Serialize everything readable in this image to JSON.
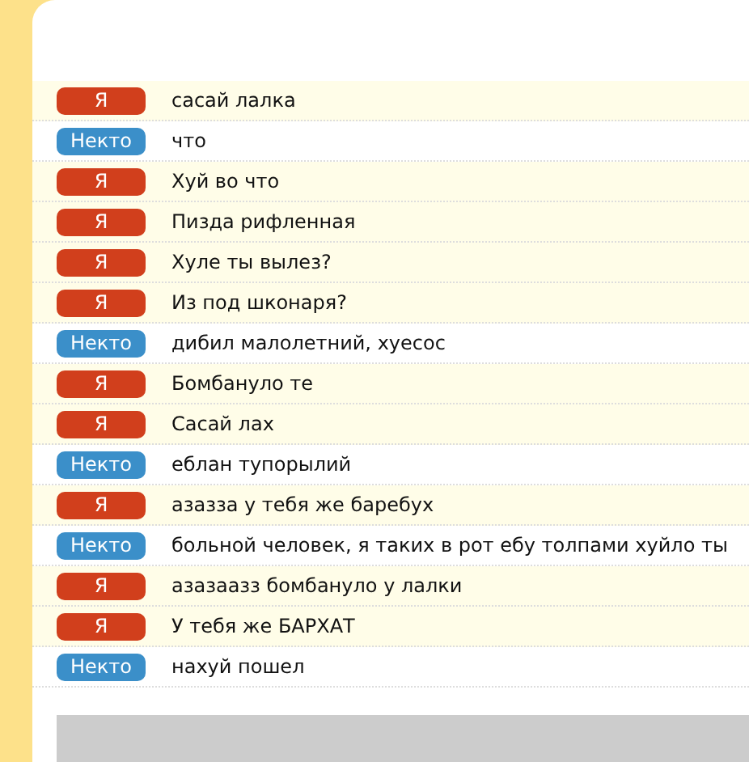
{
  "messages": [
    {
      "kind": "me",
      "author": "Я",
      "text": "сасай лалка"
    },
    {
      "kind": "stranger",
      "author": "Некто",
      "text": "что"
    },
    {
      "kind": "me",
      "author": "Я",
      "text": "Хуй во что"
    },
    {
      "kind": "me",
      "author": "Я",
      "text": "Пизда рифленная"
    },
    {
      "kind": "me",
      "author": "Я",
      "text": "Хуле ты вылез?"
    },
    {
      "kind": "me",
      "author": "Я",
      "text": "Из под шконаря?"
    },
    {
      "kind": "stranger",
      "author": "Некто",
      "text": "дибил малолетний, хуесос"
    },
    {
      "kind": "me",
      "author": "Я",
      "text": "Бомбануло те"
    },
    {
      "kind": "me",
      "author": "Я",
      "text": "Сасай лах"
    },
    {
      "kind": "stranger",
      "author": "Некто",
      "text": "еблан тупорылий"
    },
    {
      "kind": "me",
      "author": "Я",
      "text": "азазза у тебя же баребух"
    },
    {
      "kind": "stranger",
      "author": "Некто",
      "text": "больной человек, я таких в рот ебу толпами хуйло ты"
    },
    {
      "kind": "me",
      "author": "Я",
      "text": "азазаазз бомбануло у лалки"
    },
    {
      "kind": "me",
      "author": "Я",
      "text": "У тебя же БАРХАТ"
    },
    {
      "kind": "stranger",
      "author": "Некто",
      "text": "нахуй пошел"
    }
  ]
}
